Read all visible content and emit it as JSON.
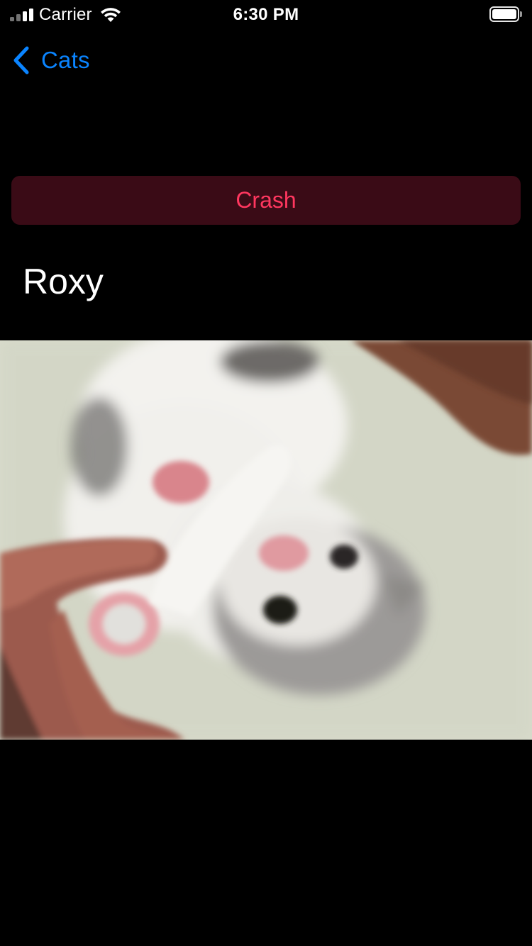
{
  "status_bar": {
    "carrier": "Carrier",
    "time": "6:30 PM"
  },
  "nav": {
    "back_label": "Cats"
  },
  "actions": {
    "crash_label": "Crash"
  },
  "cat": {
    "name": "Roxy"
  },
  "colors": {
    "background": "#000000",
    "accent_blue": "#0A84FF",
    "crash_text": "#FF375F",
    "crash_bg": "#3A0B16"
  },
  "icons": {
    "signal": "cellular-signal-icon",
    "wifi": "wifi-icon",
    "battery": "battery-icon",
    "back": "chevron-left-icon"
  }
}
